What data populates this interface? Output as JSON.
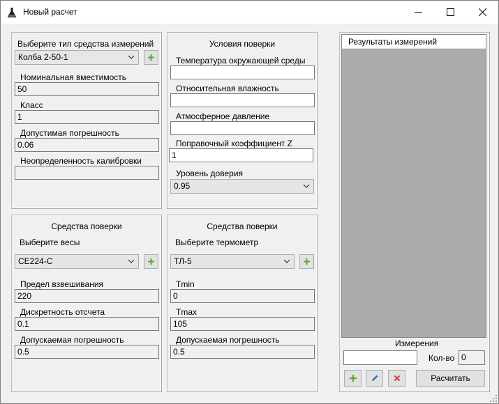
{
  "window": {
    "title": "Новый расчет"
  },
  "colors": {
    "add_green": "#5aa832",
    "delete_red": "#d83b3b",
    "edit_blue": "#2f6fb5",
    "list_bg": "#ababab"
  },
  "panel_instrument": {
    "type_label": "Выберите тип средства измерений",
    "type_value": "Колба 2-50-1",
    "nominal_label": "Номинальная вместимость",
    "nominal_value": "50",
    "class_label": "Класс",
    "class_value": "1",
    "tolerance_label": "Допустимая погрешность",
    "tolerance_value": "0.06",
    "calibration_label": "Неопределенность калибровки",
    "calibration_value": ""
  },
  "panel_conditions": {
    "title": "Условия поверки",
    "temperature_label": "Температура окружающей среды",
    "temperature_value": "",
    "humidity_label": "Относительная влажность",
    "humidity_value": "",
    "pressure_label": "Атмосферное давление",
    "pressure_value": "",
    "z_label": "Поправочный коэффициент Z",
    "z_value": "1",
    "confidence_label": "Уровень доверия",
    "confidence_value": "0.95"
  },
  "panel_scales": {
    "title": "Средства поверки",
    "select_label": "Выберите весы",
    "select_value": "CE224-C",
    "limit_label": "Предел взвешивания",
    "limit_value": "220",
    "discreteness_label": "Дискретность отсчета",
    "discreteness_value": "0.1",
    "error_label": "Допускаемая погрешность",
    "error_value": "0.5"
  },
  "panel_thermometer": {
    "title": "Средства поверки",
    "select_label": "Выберите термометр",
    "select_value": "ТЛ-5",
    "tmin_label": "Tmin",
    "tmin_value": "0",
    "tmax_label": "Tmax",
    "tmax_value": "105",
    "error_label": "Допускаемая погрешность",
    "error_value": "0.5"
  },
  "results": {
    "header": "Результаты измерений",
    "measurements_label": "Измерения",
    "measurement_input": "",
    "count_label": "Кол-во",
    "count_value": "0",
    "calculate_label": "Расчитать"
  },
  "icons": {
    "app": "flask-icon",
    "minimize": "minimize-icon",
    "maximize": "maximize-icon",
    "close": "close-icon",
    "add": "plus-icon",
    "edit": "pencil-icon",
    "delete": "x-icon",
    "dropdown": "chevron-down-icon"
  }
}
